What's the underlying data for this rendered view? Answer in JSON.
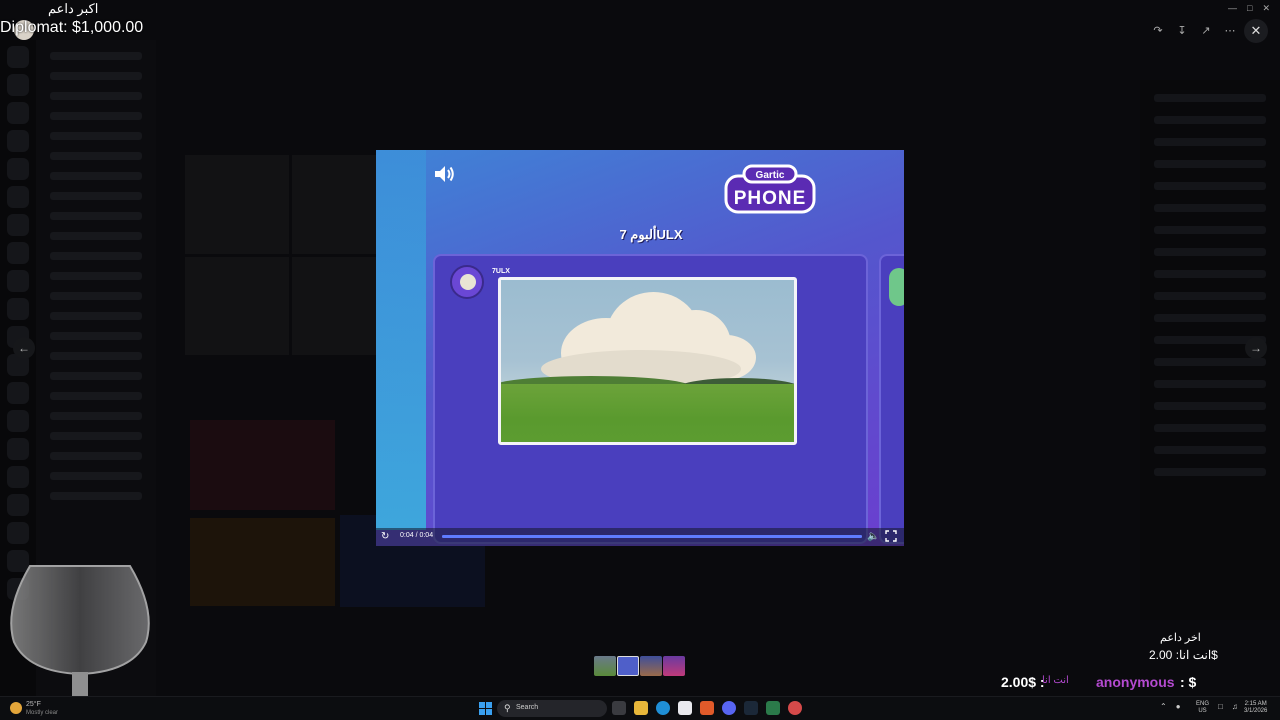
{
  "overlay": {
    "top_donor_title": "اكبر داعم",
    "top_donor_amount": "Diplomat: $1,000.00",
    "last_donor_title": "اخر داعم",
    "last_donor_amount": "انت انا: 2.00$",
    "anonymous_name": "anonymous",
    "anonymous_suffix": ": $",
    "you_label": "انت انا",
    "you_amount": "2.00$ :"
  },
  "player": {
    "album_title": "ألبوم 7ULX",
    "author": "7ULX",
    "time": "0:04 / 0:04",
    "progress": 1.0,
    "logo_top": "Gartic",
    "logo_bottom": "PHONE"
  },
  "viewer": {
    "prev_icon": "arrow-left-icon",
    "next_icon": "arrow-right-icon",
    "close_icon": "close-icon"
  },
  "taskbar": {
    "weather_temp": "25°F",
    "weather_desc": "Mostly clear",
    "search_label": "Search",
    "lang_top": "ENG",
    "lang_bottom": "US",
    "time": "2:15 AM",
    "date": "3/1/2026"
  },
  "colors": {
    "player_gradient_start": "#3f84d6",
    "player_gradient_end": "#6b3ecf",
    "donor_accent": "#b44ad0",
    "start_blue": "#3aa0f0"
  }
}
